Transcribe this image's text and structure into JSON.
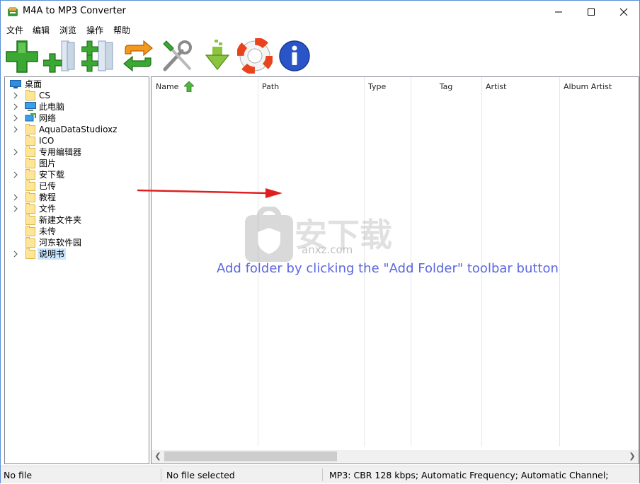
{
  "window": {
    "title": "M4A to MP3 Converter"
  },
  "menu": [
    "文件",
    "编辑",
    "浏览",
    "操作",
    "帮助"
  ],
  "toolbar": [
    {
      "name": "add-files-button",
      "icon": "green-plus-icon"
    },
    {
      "name": "add-folder-button",
      "icon": "plus-folder-icon"
    },
    {
      "name": "add-folder-recursive-button",
      "icon": "plus-folders-icon"
    },
    {
      "name": "convert-button",
      "icon": "convert-arrows-icon"
    },
    {
      "name": "settings-button",
      "icon": "tools-icon"
    },
    {
      "name": "download-button",
      "icon": "download-arrow-icon"
    },
    {
      "name": "help-button",
      "icon": "lifebuoy-icon"
    },
    {
      "name": "about-button",
      "icon": "info-icon"
    }
  ],
  "tree": {
    "root": "桌面",
    "items": [
      {
        "label": "CS",
        "expandable": true,
        "icon": "folder-icon"
      },
      {
        "label": "此电脑",
        "expandable": true,
        "icon": "computer-icon"
      },
      {
        "label": "网络",
        "expandable": true,
        "icon": "network-icon"
      },
      {
        "label": "AquaDataStudioxz",
        "expandable": true,
        "icon": "folder-icon"
      },
      {
        "label": "ICO",
        "expandable": false,
        "icon": "folder-icon"
      },
      {
        "label": "专用编辑器",
        "expandable": true,
        "icon": "folder-icon"
      },
      {
        "label": "图片",
        "expandable": false,
        "icon": "folder-icon"
      },
      {
        "label": "安下载",
        "expandable": true,
        "icon": "folder-icon"
      },
      {
        "label": "已传",
        "expandable": false,
        "icon": "folder-icon"
      },
      {
        "label": "教程",
        "expandable": true,
        "icon": "folder-icon"
      },
      {
        "label": "文件",
        "expandable": true,
        "icon": "folder-icon"
      },
      {
        "label": "新建文件夹",
        "expandable": false,
        "icon": "folder-icon"
      },
      {
        "label": "未传",
        "expandable": false,
        "icon": "folder-icon"
      },
      {
        "label": "河东软件园",
        "expandable": false,
        "icon": "folder-icon"
      },
      {
        "label": "说明书",
        "expandable": true,
        "icon": "folder-icon",
        "selected": true
      }
    ]
  },
  "list": {
    "columns": [
      "Name",
      "Path",
      "Type",
      "Tag",
      "Artist",
      "Album Artist"
    ],
    "sort_column": "Name",
    "hint": "Add folder by clicking the \"Add Folder\" toolbar button"
  },
  "watermark": {
    "text": "安下载",
    "url": "anxz.com"
  },
  "status": {
    "left": "No file",
    "middle": "No file selected",
    "right": "MP3:  CBR 128 kbps; Automatic Frequency; Automatic Channel;"
  },
  "colors": {
    "hint": "#5a67e0",
    "selection": "#cce8ff",
    "arrow": "#e02020"
  }
}
